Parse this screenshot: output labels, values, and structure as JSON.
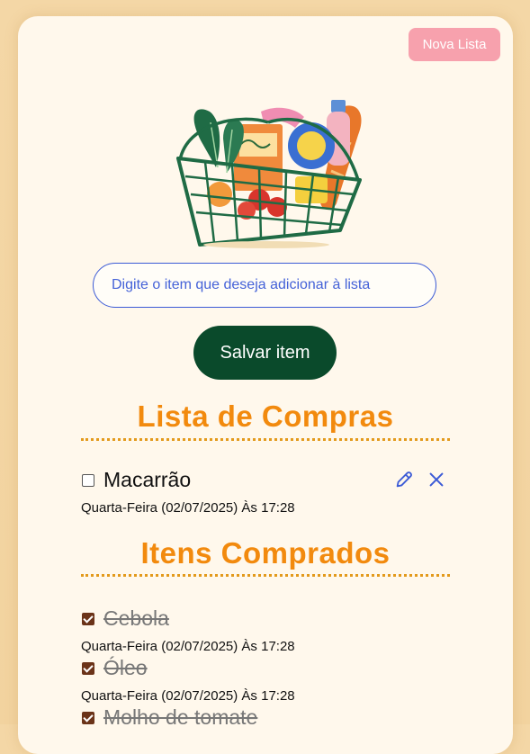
{
  "header": {
    "new_list_label": "Nova Lista"
  },
  "form": {
    "placeholder": "Digite o item que deseja adicionar à lista",
    "save_label": "Salvar item"
  },
  "pending": {
    "title": "Lista de Compras",
    "items": [
      {
        "name": "Macarrão",
        "date": "Quarta-Feira (02/07/2025) Às 17:28",
        "checked": false
      }
    ]
  },
  "bought": {
    "title": "Itens Comprados",
    "items": [
      {
        "name": "Cebola",
        "date": "Quarta-Feira (02/07/2025) Às 17:28",
        "checked": true
      },
      {
        "name": "Óleo",
        "date": "Quarta-Feira (02/07/2025) Às 17:28",
        "checked": true
      },
      {
        "name": "Molho de tomate",
        "checked": true
      }
    ]
  },
  "icons": {
    "edit": "pencil-icon",
    "delete": "close-icon",
    "illustration": "shopping-basket-illustration"
  },
  "colors": {
    "accent": "#f28a0e",
    "primary_button": "#0a4a2b",
    "new_list_button": "#f7a1ad",
    "input_border": "#3c5bd6",
    "icon_blue": "#3c5bd6"
  }
}
